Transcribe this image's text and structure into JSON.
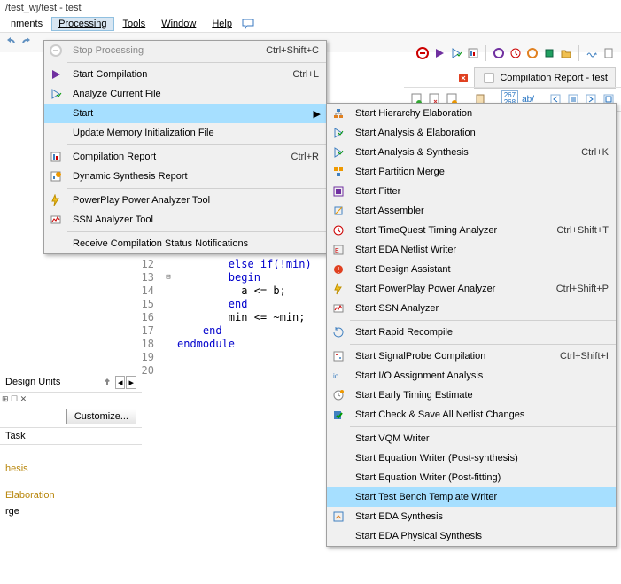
{
  "title": "/test_wj/test - test",
  "menus": {
    "assignments": "nments",
    "processing": "Processing",
    "tools": "Tools",
    "window": "Window",
    "help": "Help"
  },
  "dropdown": {
    "stop": "Stop Processing",
    "stop_sc": "Ctrl+Shift+C",
    "startcomp": "Start Compilation",
    "startcomp_sc": "Ctrl+L",
    "analyze": "Analyze Current File",
    "start": "Start",
    "update": "Update Memory Initialization File",
    "report": "Compilation Report",
    "report_sc": "Ctrl+R",
    "dynsynth": "Dynamic Synthesis Report",
    "powerplay": "PowerPlay Power Analyzer Tool",
    "ssn": "SSN Analyzer Tool",
    "receive": "Receive Compilation Status Notifications"
  },
  "submenu": {
    "hier": "Start Hierarchy Elaboration",
    "ae": "Start Analysis & Elaboration",
    "as": "Start Analysis & Synthesis",
    "as_sc": "Ctrl+K",
    "pm": "Start Partition Merge",
    "fitter": "Start Fitter",
    "asm": "Start Assembler",
    "tq": "Start TimeQuest Timing Analyzer",
    "tq_sc": "Ctrl+Shift+T",
    "eda": "Start EDA Netlist Writer",
    "da": "Start Design Assistant",
    "pp": "Start PowerPlay Power Analyzer",
    "pp_sc": "Ctrl+Shift+P",
    "ssn2": "Start SSN Analyzer",
    "rr": "Start Rapid Recompile",
    "sp": "Start SignalProbe Compilation",
    "sp_sc": "Ctrl+Shift+I",
    "io": "Start I/O Assignment Analysis",
    "ete": "Start Early Timing Estimate",
    "csa": "Start Check & Save All Netlist Changes",
    "vqm": "Start VQM Writer",
    "eqs": "Start Equation Writer (Post-synthesis)",
    "eqf": "Start Equation Writer (Post-fitting)",
    "tb": "Start Test Bench Template Writer",
    "edas": "Start EDA Synthesis",
    "edaps": "Start EDA Physical Synthesis"
  },
  "tab": "Compilation Report - test",
  "code": {
    "l12": "else if(!min)",
    "l13": "begin",
    "l14": "a <= b;",
    "l15": "end",
    "l16": "min <= ~min;",
    "l17": "end",
    "l18": "endmodule"
  },
  "lines": [
    "12",
    "13",
    "14",
    "15",
    "16",
    "17",
    "18",
    "19",
    "20"
  ],
  "panel": {
    "design_units": "Design Units",
    "customize": "Customize...",
    "task": "Task",
    "hesis": "hesis",
    "elaboration": "Elaboration",
    "rge": "rge"
  },
  "icons_267": "267",
  "icons_268": "268",
  "icons_ab": "ab/"
}
